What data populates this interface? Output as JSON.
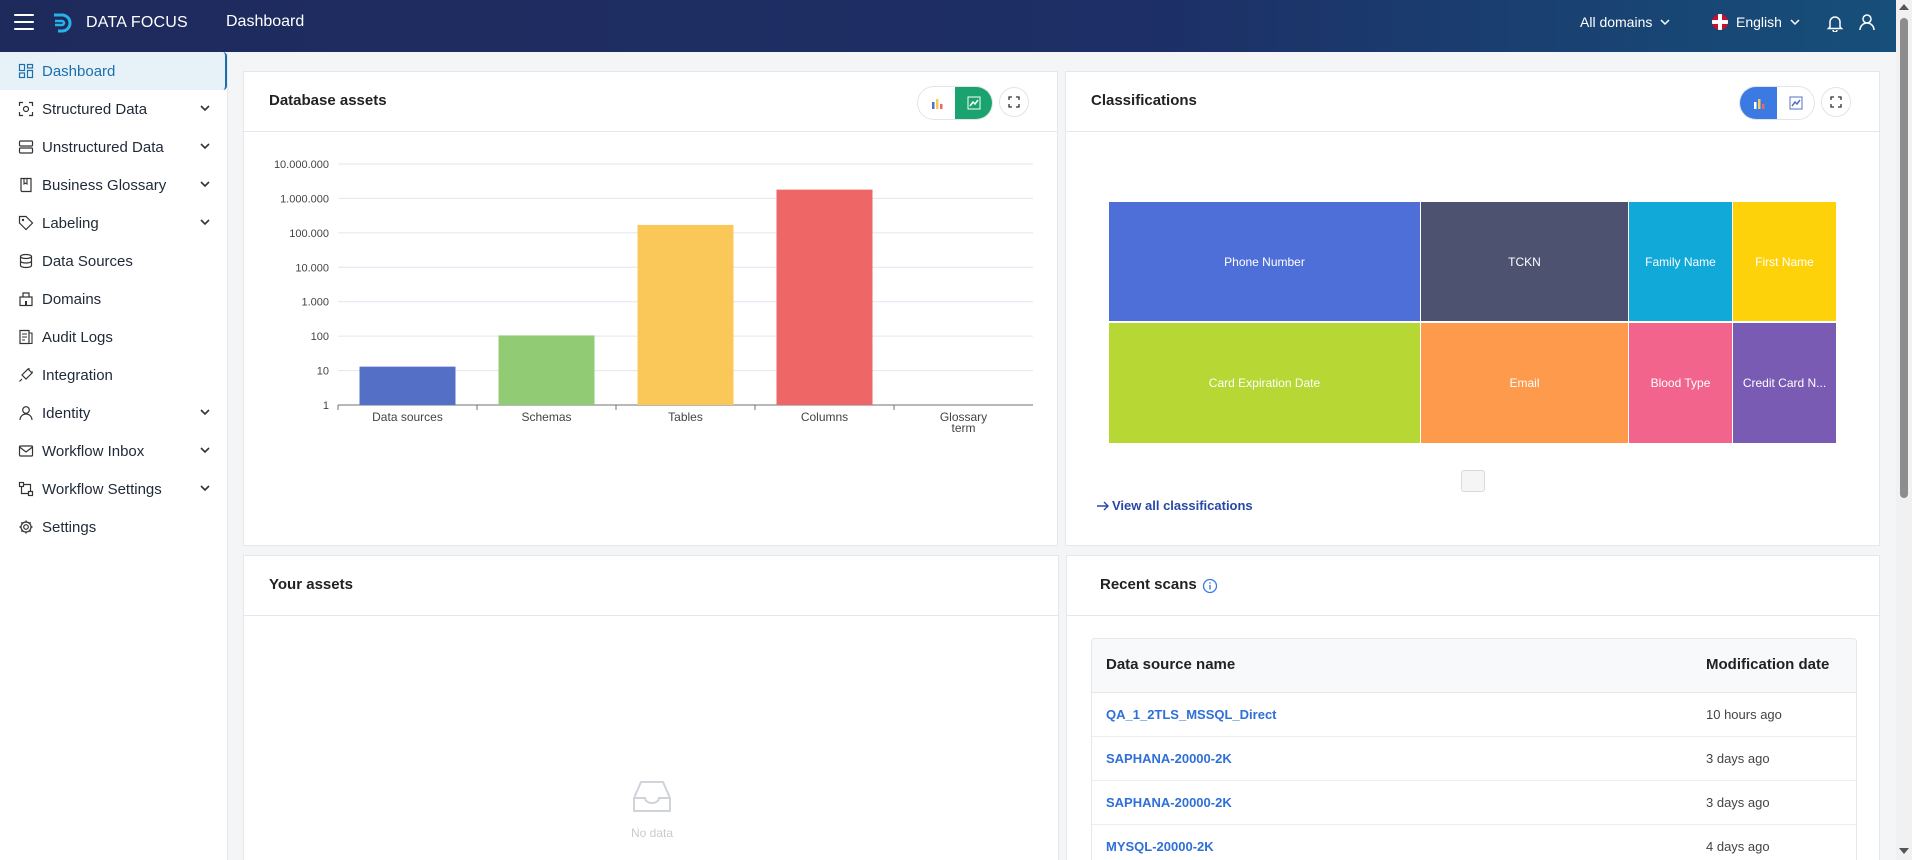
{
  "app": {
    "brand": "DATA FOCUS",
    "page_title": "Dashboard"
  },
  "header": {
    "domains": "All domains",
    "language": "English"
  },
  "sidebar": {
    "items": [
      {
        "label": "Dashboard",
        "icon": "dashboard-icon",
        "active": true
      },
      {
        "label": "Structured Data",
        "icon": "structured-data-icon",
        "expandable": true
      },
      {
        "label": "Unstructured Data",
        "icon": "unstructured-data-icon",
        "expandable": true
      },
      {
        "label": "Business Glossary",
        "icon": "book-icon",
        "expandable": true
      },
      {
        "label": "Labeling",
        "icon": "tag-icon",
        "expandable": true
      },
      {
        "label": "Data Sources",
        "icon": "database-icon"
      },
      {
        "label": "Domains",
        "icon": "building-icon"
      },
      {
        "label": "Audit Logs",
        "icon": "audit-log-icon"
      },
      {
        "label": "Integration",
        "icon": "plug-icon"
      },
      {
        "label": "Identity",
        "icon": "user-icon",
        "expandable": true
      },
      {
        "label": "Workflow Inbox",
        "icon": "mail-icon",
        "expandable": true
      },
      {
        "label": "Workflow Settings",
        "icon": "workflow-icon",
        "expandable": true
      },
      {
        "label": "Settings",
        "icon": "gear-icon"
      }
    ]
  },
  "database_assets": {
    "title": "Database assets",
    "chart_data": {
      "type": "bar",
      "categories": [
        "Data sources",
        "Schemas",
        "Tables",
        "Columns",
        "Glossary term"
      ],
      "values": [
        13,
        105,
        170000,
        1800000,
        0
      ],
      "y_scale": "log",
      "ylim": [
        1,
        10000000
      ],
      "y_ticks": [
        "1",
        "10",
        "100",
        "1.000",
        "10.000",
        "100.000",
        "1.000.000",
        "10.000.000"
      ],
      "colors": [
        "#5470c6",
        "#91cc75",
        "#fac858",
        "#ee6666",
        "#73c0de"
      ],
      "grid": true
    }
  },
  "classifications": {
    "title": "Classifications",
    "chart_data": {
      "type": "treemap",
      "items": [
        {
          "label": "Phone Number",
          "color": "#4f6fd8"
        },
        {
          "label": "TCKN",
          "color": "#4d5270"
        },
        {
          "label": "Family Name",
          "color": "#11a9d8"
        },
        {
          "label": "First Name",
          "color": "#fdd20a"
        },
        {
          "label": "Card Expiration Date",
          "color": "#b6d734"
        },
        {
          "label": "Email",
          "color": "#fd9a4b"
        },
        {
          "label": "Blood Type",
          "color": "#f3648c"
        },
        {
          "label": "Credit Card N...",
          "color": "#7a5bb3"
        }
      ]
    },
    "view_all": "View all classifications"
  },
  "your_assets": {
    "title": "Your assets",
    "empty_text": "No data"
  },
  "recent_scans": {
    "title": "Recent scans",
    "columns": [
      "Data source name",
      "Modification date"
    ],
    "rows": [
      {
        "name": "QA_1_2TLS_MSSQL_Direct",
        "date": "10 hours ago"
      },
      {
        "name": "SAPHANA-20000-2K",
        "date": "3 days ago"
      },
      {
        "name": "SAPHANA-20000-2K",
        "date": "3 days ago"
      },
      {
        "name": "MYSQL-20000-2K",
        "date": "4 days ago"
      }
    ]
  }
}
